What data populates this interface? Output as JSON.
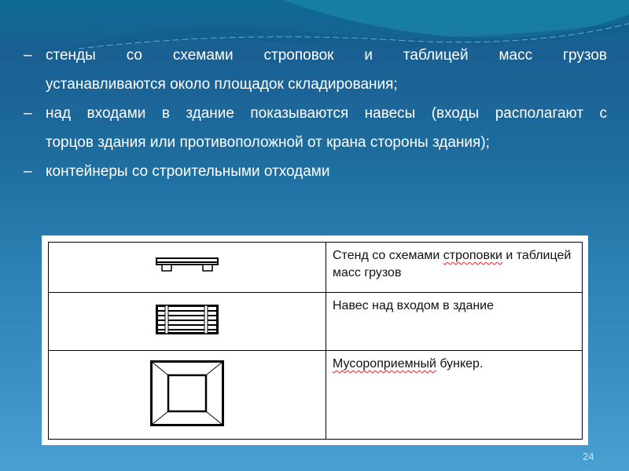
{
  "slide": {
    "page_number": "24",
    "bullets": [
      {
        "line1": "стенды со схемами строповок и таблицей масс грузов",
        "line2": "устанавливаются около площадок складирования;"
      },
      {
        "line1": "над входами в здание показываются навесы (входы располагают с",
        "line2": "торцов здания или противоположной от крана стороны здания);"
      },
      {
        "line1": "контейнеры со строительными отходами",
        "line2": ""
      }
    ],
    "bullet_marker": "–"
  },
  "table": {
    "rows": [
      {
        "symbol": "stand-symbol-icon",
        "text_plain": "Стенд со схемами ",
        "text_underlined": "строповки",
        "text_rest": " и таблицей масс грузов"
      },
      {
        "symbol": "canopy-symbol-icon",
        "text_plain": "Навес над входом в здание",
        "text_underlined": "",
        "text_rest": ""
      },
      {
        "symbol": "waste-bunker-symbol-icon",
        "text_plain": "",
        "text_underlined": "Мусороприемный",
        "text_rest": " бункер."
      }
    ]
  }
}
